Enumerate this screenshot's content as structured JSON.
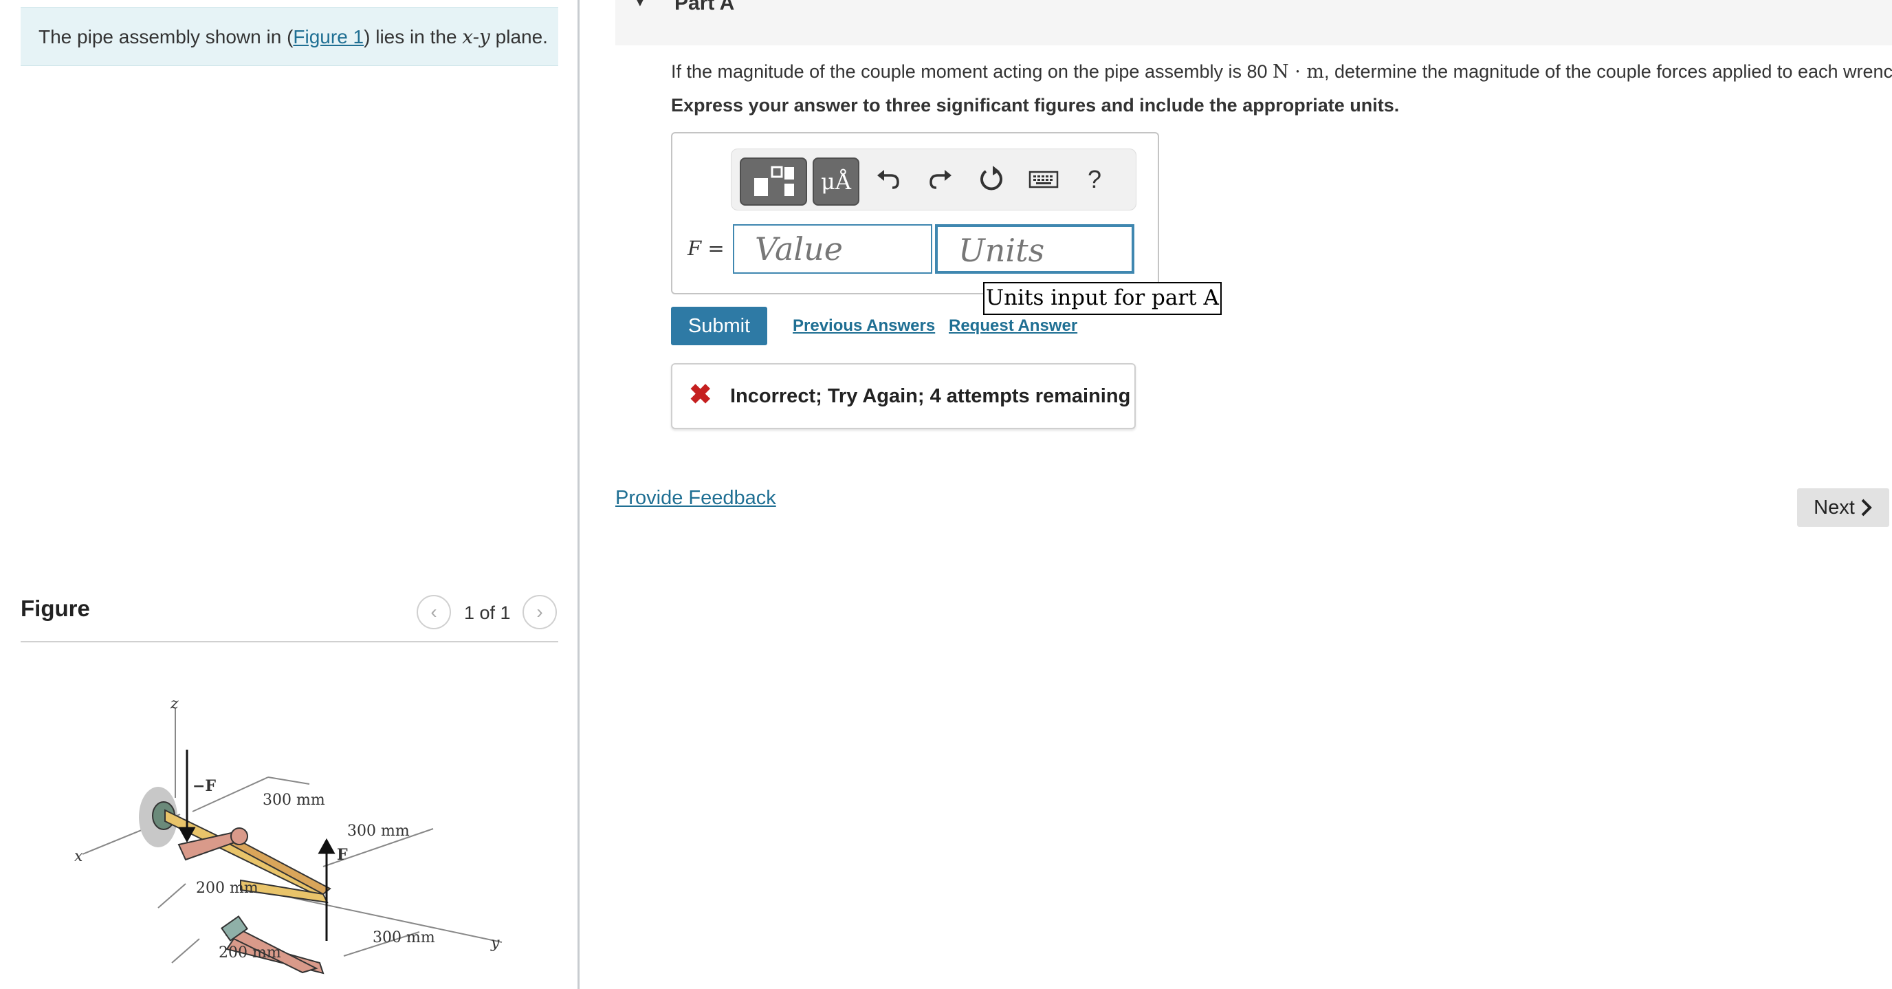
{
  "intro": {
    "text_before": "The pipe assembly shown in (",
    "figure_link": "Figure 1",
    "text_middle": ") lies in the ",
    "plane_var": "x-y",
    "text_after": " plane."
  },
  "figure": {
    "title": "Figure",
    "counter": "1 of 1",
    "labels": {
      "z": "z",
      "x": "x",
      "y": "y",
      "neg_f": "−F",
      "f": "F",
      "dim_300_a": "300 mm",
      "dim_300_b": "300 mm",
      "dim_300_c": "300 mm",
      "dim_200_a": "200 mm",
      "dim_200_b": "200 mm"
    }
  },
  "part": {
    "title": "Part A",
    "question_before": "If the magnitude of the couple moment acting on the pipe assembly is 80 ",
    "question_unit": "N · m",
    "question_after": ", determine the magnitude of the couple forces applied to each wrench.",
    "instruction": "Express your answer to three significant figures and include the appropriate units."
  },
  "toolbar": {
    "units_button": "μÅ",
    "help": "?",
    "icons": [
      "templates-icon",
      "units-icon",
      "undo-icon",
      "redo-icon",
      "reset-icon",
      "keyboard-icon",
      "help-icon"
    ]
  },
  "answer": {
    "variable_label": "F =",
    "value_placeholder": "Value",
    "units_placeholder": "Units",
    "units_tooltip": "Units input for part A"
  },
  "actions": {
    "submit": "Submit",
    "previous_answers": "Previous Answers",
    "request_answer": "Request Answer"
  },
  "feedback": {
    "message": "Incorrect; Try Again; 4 attempts remaining"
  },
  "footer": {
    "provide_feedback": "Provide Feedback",
    "next": "Next"
  },
  "colors": {
    "accent": "#2e7aa5",
    "link": "#1f6f93",
    "error": "#c51f1f",
    "intro_bg": "#e6f3f6"
  }
}
